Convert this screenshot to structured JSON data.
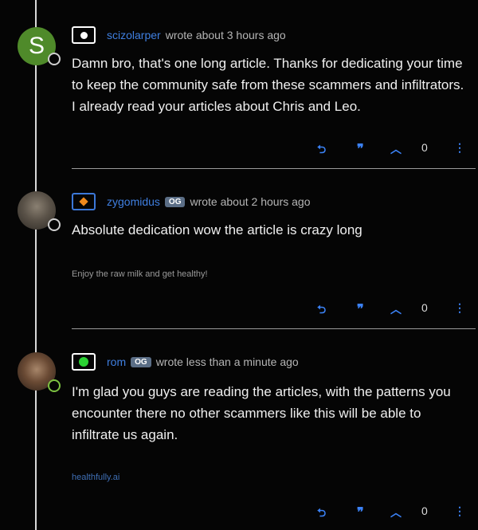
{
  "posts": [
    {
      "avatar_letter": "S",
      "username": "scizolarper",
      "og": "",
      "meta_text": "wrote about 3 hours ago",
      "body": "Damn bro, that's one long article. Thanks for dedicating your time to keep the community safe from these scammers and infiltrators. I already read your articles about Chris and Leo.",
      "signature": "",
      "votes": "0"
    },
    {
      "avatar_letter": "",
      "username": "zygomidus",
      "og": "OG",
      "meta_text": "wrote about 2 hours ago",
      "body": "Absolute dedication wow the article is crazy long",
      "signature": "Enjoy the raw milk and get healthy!",
      "votes": "0"
    },
    {
      "avatar_letter": "",
      "username": "rom",
      "og": "OG",
      "meta_text": "wrote less than a minute ago",
      "body": "I'm glad you guys are reading the articles, with the patterns you encounter there no other scammers like this will be able to infiltrate us again.",
      "signature": "healthfully.ai",
      "votes": "0"
    }
  ],
  "icons": {
    "reply": "reply-icon",
    "quote": "quote-icon",
    "upvote": "chevron-up-icon",
    "more": "more-vertical-icon",
    "accent": "#3b82f6",
    "username_color": "#3f7fe0"
  }
}
